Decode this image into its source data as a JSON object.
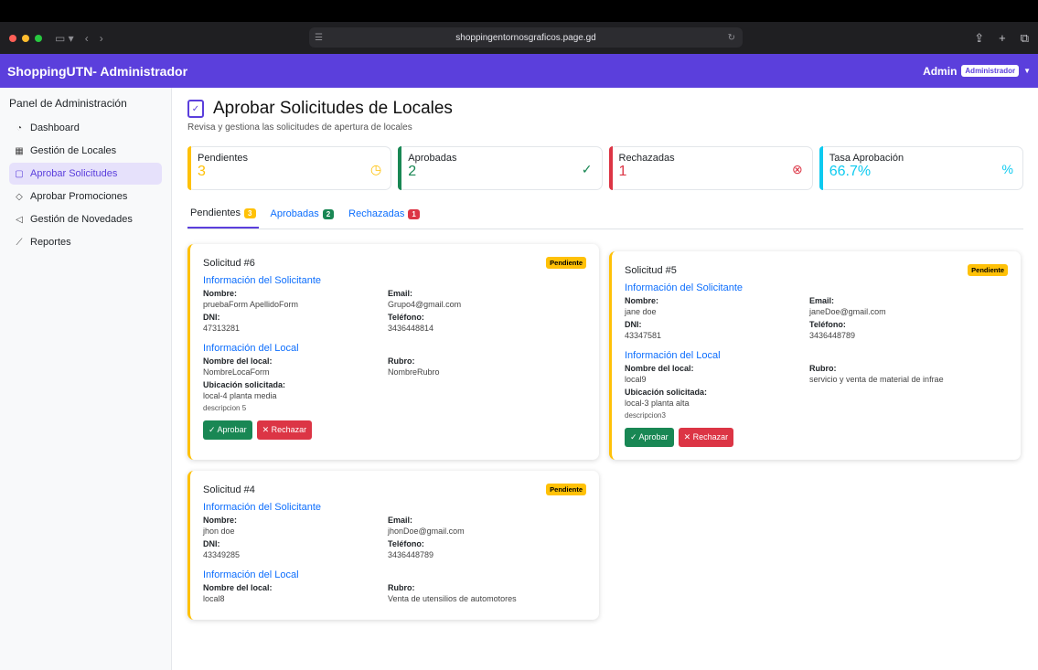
{
  "browser": {
    "url": "shoppingentornosgraficos.page.gd"
  },
  "navbar": {
    "brand": "ShoppingUTN- Administrador",
    "user": "Admin",
    "role": "Administrador"
  },
  "sidebar": {
    "title": "Panel de Administración",
    "items": [
      {
        "label": "Dashboard",
        "icon": "dashboard-icon"
      },
      {
        "label": "Gestión de Locales",
        "icon": "store-icon"
      },
      {
        "label": "Aprobar Solicitudes",
        "icon": "clipboard-icon"
      },
      {
        "label": "Aprobar Promociones",
        "icon": "tag-icon"
      },
      {
        "label": "Gestión de Novedades",
        "icon": "megaphone-icon"
      },
      {
        "label": "Reportes",
        "icon": "chart-icon"
      }
    ]
  },
  "page": {
    "title": "Aprobar Solicitudes de Locales",
    "subtitle": "Revisa y gestiona las solicitudes de apertura de locales"
  },
  "stats": [
    {
      "label": "Pendientes",
      "value": "3",
      "color": "#ffc107"
    },
    {
      "label": "Aprobadas",
      "value": "2",
      "color": "#198754"
    },
    {
      "label": "Rechazadas",
      "value": "1",
      "color": "#dc3545"
    },
    {
      "label": "Tasa Aprobación",
      "value": "66.7%",
      "color": "#0dcaf0"
    }
  ],
  "tabs": [
    {
      "label": "Pendientes",
      "count": "3"
    },
    {
      "label": "Aprobadas",
      "count": "2"
    },
    {
      "label": "Rechazadas",
      "count": "1"
    }
  ],
  "labels": {
    "applicant_section": "Información del Solicitante",
    "local_section": "Información del Local",
    "name": "Nombre:",
    "email": "Email:",
    "dni": "DNI:",
    "phone": "Teléfono:",
    "local_name": "Nombre del local:",
    "rubro": "Rubro:",
    "location": "Ubicación solicitada:",
    "approve": "Aprobar",
    "reject": "Rechazar",
    "status": "Pendiente"
  },
  "requests": [
    {
      "title": "Solicitud #6",
      "name": "pruebaForm ApellidoForm",
      "email": "Grupo4@gmail.com",
      "dni": "47313281",
      "phone": "3436448814",
      "local_name": "NombreLocaForm",
      "rubro": "NombreRubro",
      "location": "local-4 planta media",
      "description": "descripcion 5"
    },
    {
      "title": "Solicitud #5",
      "name": "jane doe",
      "email": "janeDoe@gmail.com",
      "dni": "43347581",
      "phone": "3436448789",
      "local_name": "local9",
      "rubro": "servicio y venta de material de infrae",
      "location": "local-3 planta alta",
      "description": "descripcion3"
    },
    {
      "title": "Solicitud #4",
      "name": "jhon doe",
      "email": "jhonDoe@gmail.com",
      "dni": "43349285",
      "phone": "3436448789",
      "local_name": "local8",
      "rubro": "Venta de utensilios de automotores"
    }
  ]
}
